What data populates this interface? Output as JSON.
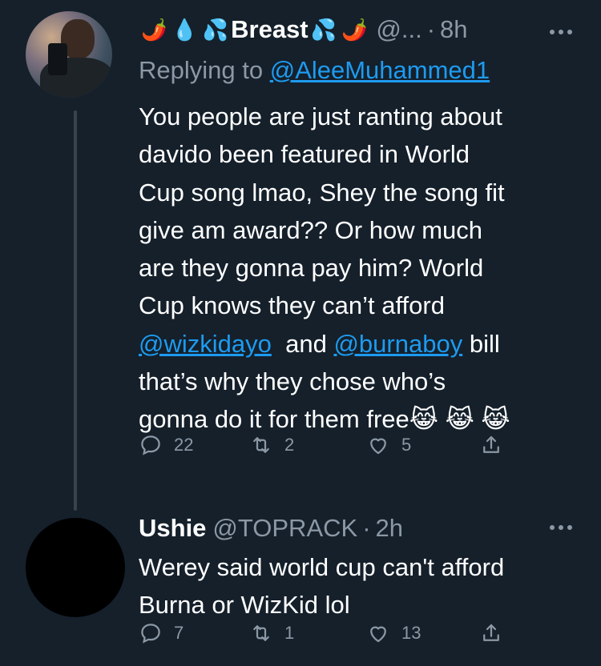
{
  "tweet1": {
    "emoji_prefix": [
      "🌶️",
      "💧",
      "💦"
    ],
    "name": "Breast",
    "emoji_suffix": [
      "💦",
      "🌶️"
    ],
    "handle": "@...",
    "time": "8h",
    "replying_label": "Replying to",
    "replying_to": "@AleeMuhammed1",
    "body_lines": [
      "You people are just ranting about",
      "davido been featured in World",
      "Cup song lmao, Shey the song fit",
      "give am award?? Or how much",
      "are they gonna pay him? World",
      "Cup knows they can’t afford"
    ],
    "mention_line": {
      "mention1": "@wizkidayo",
      "and": "and",
      "mention2": "@burnaboy",
      "tail": "bill"
    },
    "body_lines_end": [
      "that’s why they chose who’s"
    ],
    "last_line_text": "gonna do it for them free",
    "last_line_emojis": "😹 😹 😹",
    "replies": "22",
    "retweets": "2",
    "likes": "5"
  },
  "tweet2": {
    "name": "Ushie",
    "handle": "@TOPRACK",
    "time": "2h",
    "body_lines": [
      "Werey said world cup can't afford",
      "Burna or WizKid lol"
    ],
    "replies": "7",
    "retweets": "1",
    "likes": "13"
  },
  "colors": {
    "background": "#15202b",
    "text": "#ffffff",
    "secondary": "#8b98a5",
    "link": "#1d9bf0"
  },
  "icons": [
    "more-icon",
    "reply-icon",
    "retweet-icon",
    "like-icon",
    "share-icon"
  ]
}
